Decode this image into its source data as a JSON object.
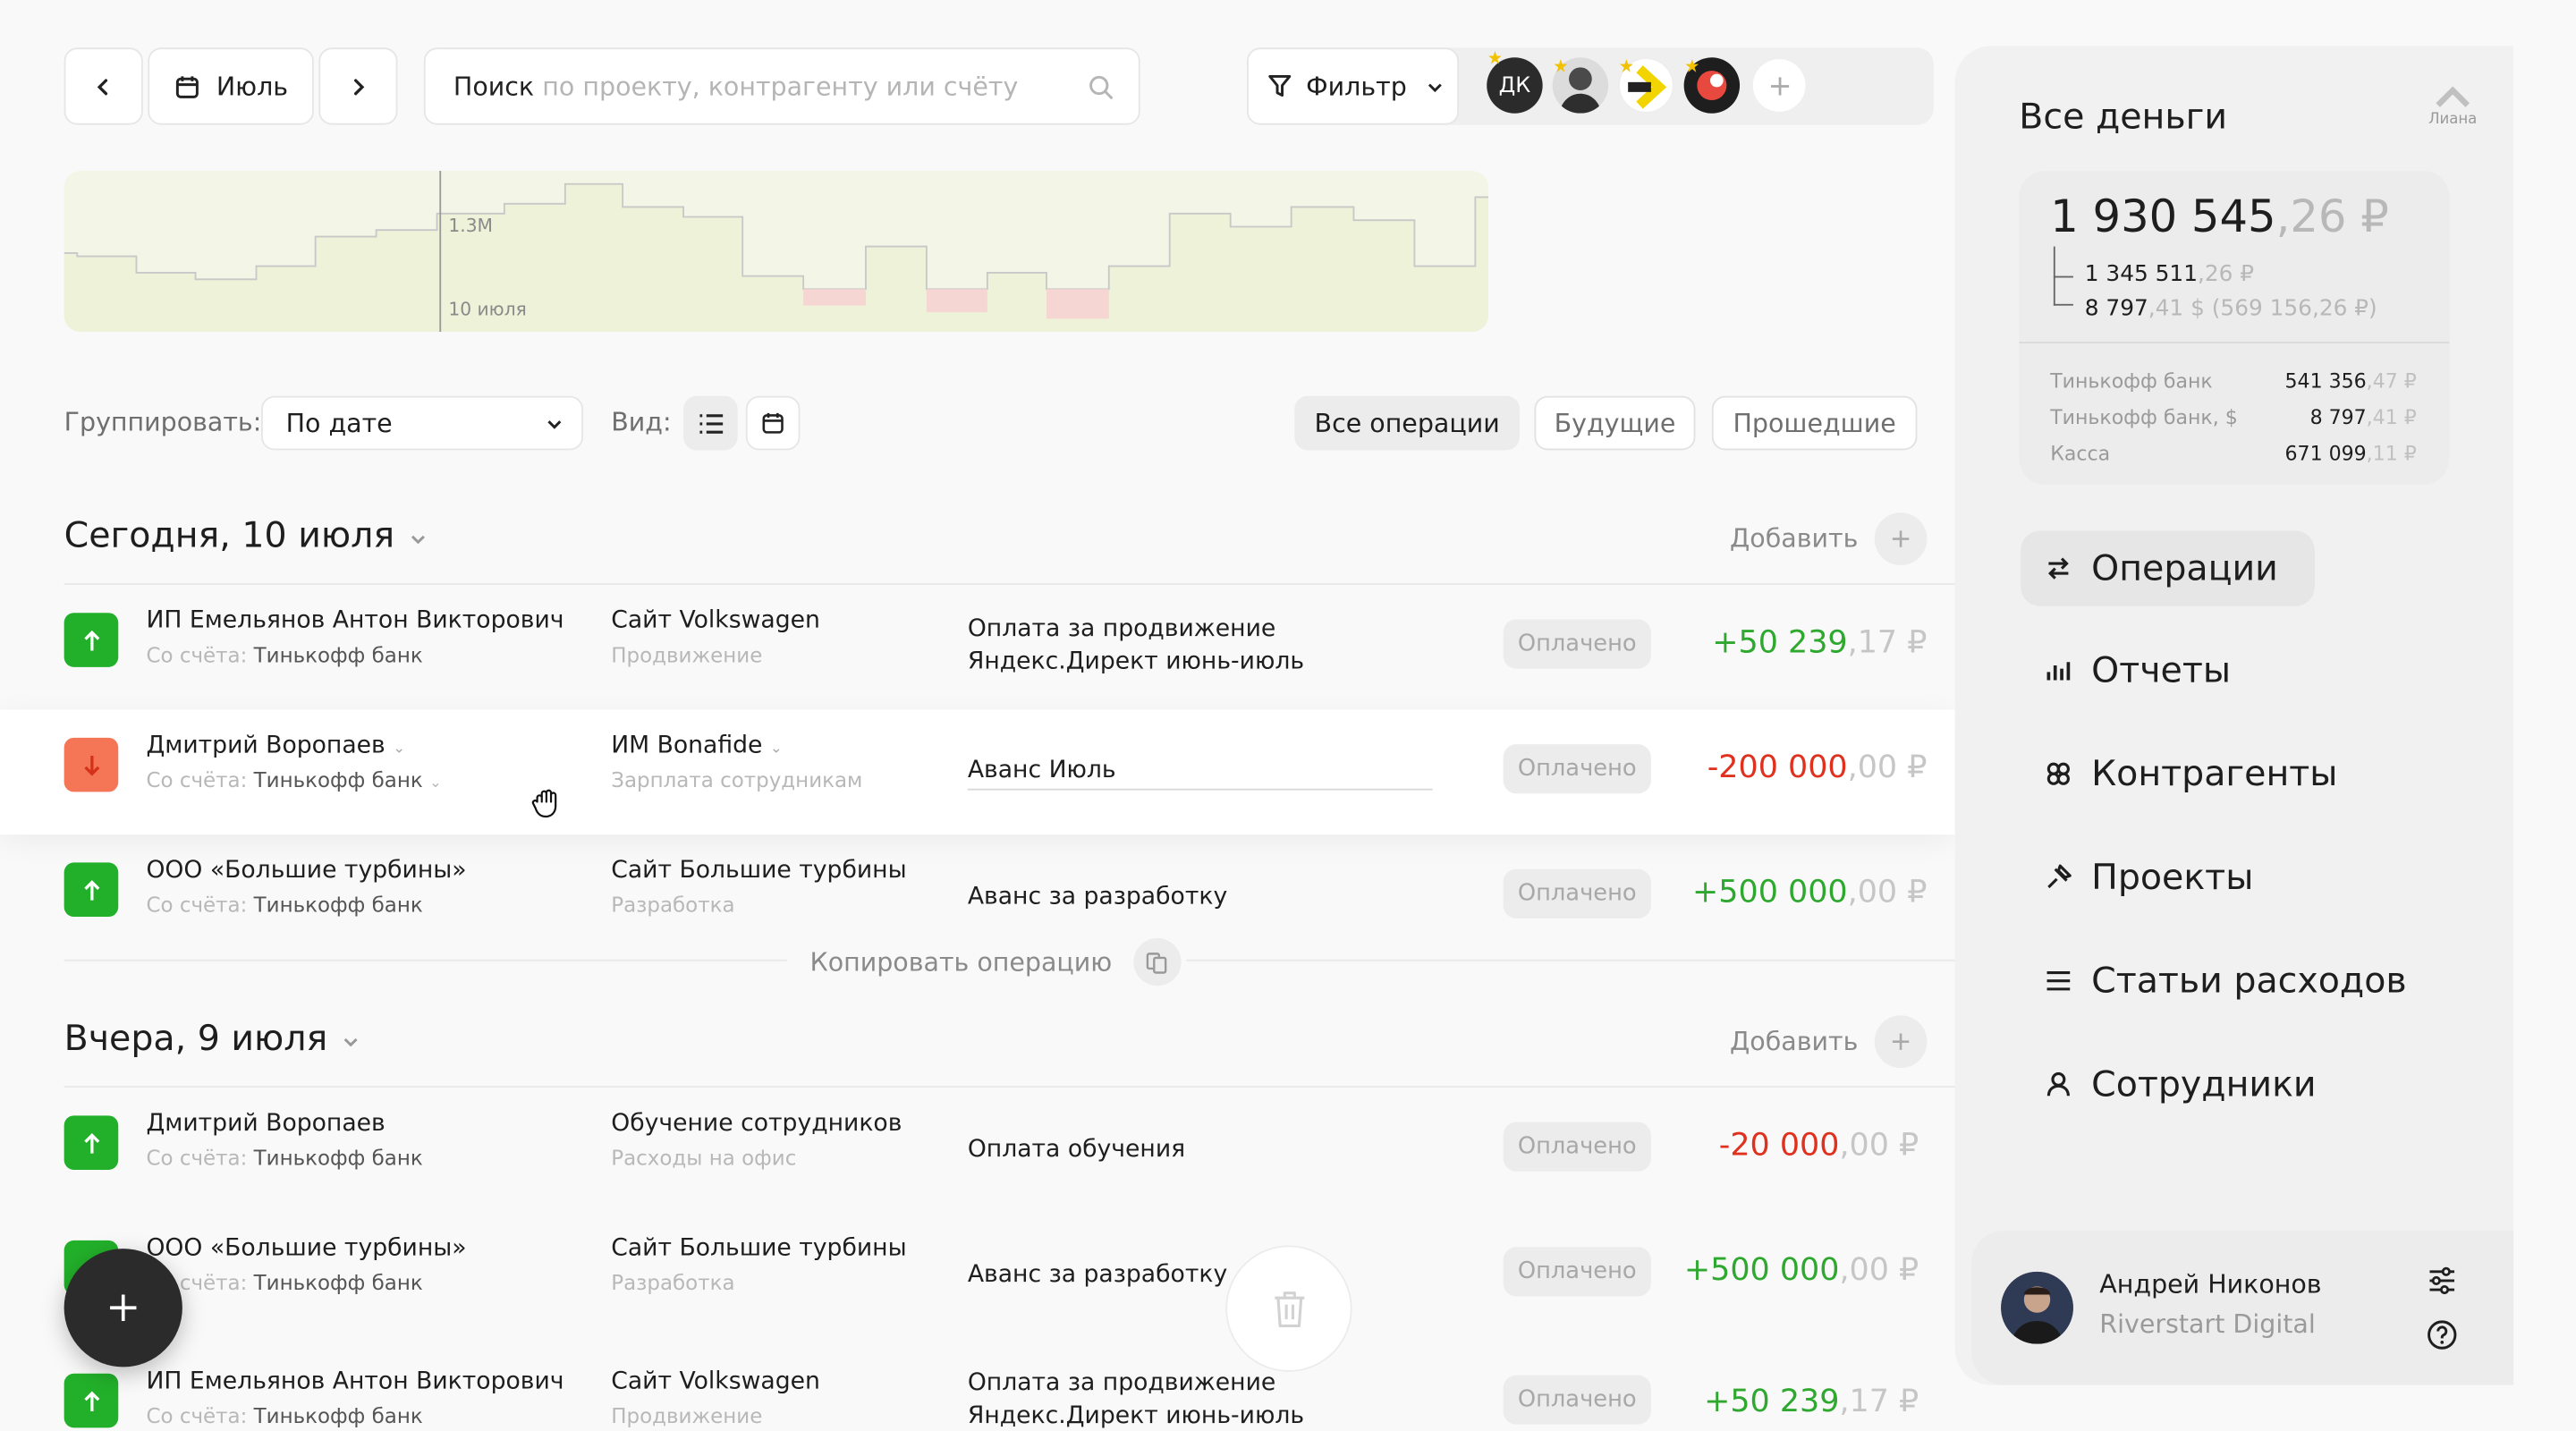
{
  "toolbar": {
    "month_label": "Июль",
    "search_bold": "Поиск",
    "search_placeholder": "по проекту, контрагенту или счёту",
    "filter_label": "Фильтр",
    "avatar_initials": "ДК"
  },
  "chart": {
    "value_label": "1.3M",
    "date_label": "10 июля"
  },
  "controls": {
    "group_label": "Группировать:",
    "group_value": "По дате",
    "view_label": "Вид:",
    "tabs": [
      "Все операции",
      "Будущие",
      "Прошедшие"
    ]
  },
  "groups": [
    {
      "title": "Сегодня, 10 июля",
      "add_label": "Добавить"
    },
    {
      "title": "Вчера, 9 июля",
      "add_label": "Добавить"
    }
  ],
  "account_prefix": "Со счёта:",
  "operations": [
    {
      "name": "ИП Емельянов Антон Викторович",
      "account": "Тинькофф банк",
      "project": "Сайт Volkswagen",
      "category": "Продвижение",
      "desc1": "Оплата за продвижение",
      "desc2": "Яндекс.Директ июнь-июль",
      "status": "Оплачено",
      "amount": "+50 239",
      "cents": ",17 ₽",
      "direction": "in"
    },
    {
      "name": "Дмитрий Воропаев",
      "account": "Тинькофф банк",
      "project": "ИМ Bonafide",
      "category": "Зарплата сотрудникам",
      "desc1": "Аванс Июль",
      "desc2": "",
      "status": "Оплачено",
      "amount": "-200 000",
      "cents": ",00 ₽",
      "direction": "out"
    },
    {
      "name": "ООО «Большие турбины»",
      "account": "Тинькофф банк",
      "project": "Сайт Большие турбины",
      "category": "Разработка",
      "desc1": "Аванс за разработку",
      "desc2": "",
      "status": "Оплачено",
      "amount": "+500 000",
      "cents": ",00 ₽",
      "direction": "in"
    },
    {
      "name": "Дмитрий Воропаев",
      "account": "Тинькофф банк",
      "project": "Обучение сотрудников",
      "category": "Расходы на офис",
      "desc1": "Оплата обучения",
      "desc2": "",
      "status": "Оплачено",
      "amount": "-20 000",
      "cents": ",00 ₽",
      "direction": "in"
    },
    {
      "name": "ООО «Большие турбины»",
      "account": "Тинькофф банк",
      "project": "Сайт Большие турбины",
      "category": "Разработка",
      "desc1": "Аванс за разработку",
      "desc2": "",
      "status": "Оплачено",
      "amount": "+500 000",
      "cents": ",00 ₽",
      "direction": "in"
    },
    {
      "name": "ИП Емельянов Антон Викторович",
      "account": "Тинькофф банк",
      "project": "Сайт Volkswagen",
      "category": "Продвижение",
      "desc1": "Оплата за продвижение",
      "desc2": "Яндекс.Директ июнь-июль",
      "status": "Оплачено",
      "amount": "+50 239",
      "cents": ",17 ₽",
      "direction": "in"
    }
  ],
  "copy_operation_label": "Копировать операцию",
  "sidebar": {
    "title": "Все деньги",
    "user_chip": "Лиана",
    "total_main": "1 930 545",
    "total_cents": ",26 ₽",
    "sub1_main": "1 345 511",
    "sub1_cents": ",26 ₽",
    "sub2_main": "8 797",
    "sub2_cents": ",41 $ (569 156,26 ₽)",
    "accounts": [
      {
        "name": "Тинькофф банк",
        "main": "541 356",
        "cents": ",47 ₽"
      },
      {
        "name": "Тинькофф банк, $",
        "main": "8 797",
        "cents": ",41 ₽"
      },
      {
        "name": "Касса",
        "main": "671 099",
        "cents": ",11 ₽"
      }
    ],
    "nav": [
      "Операции",
      "Отчеты",
      "Контрагенты",
      "Проекты",
      "Статьи расходов",
      "Сотрудники"
    ],
    "user_name": "Андрей Никонов",
    "user_company": "Riverstart Digital"
  },
  "colors": {
    "income": "#2fa82f",
    "expense": "#e0311f",
    "income_icon": "#22b02a",
    "expense_icon": "#f47657"
  }
}
